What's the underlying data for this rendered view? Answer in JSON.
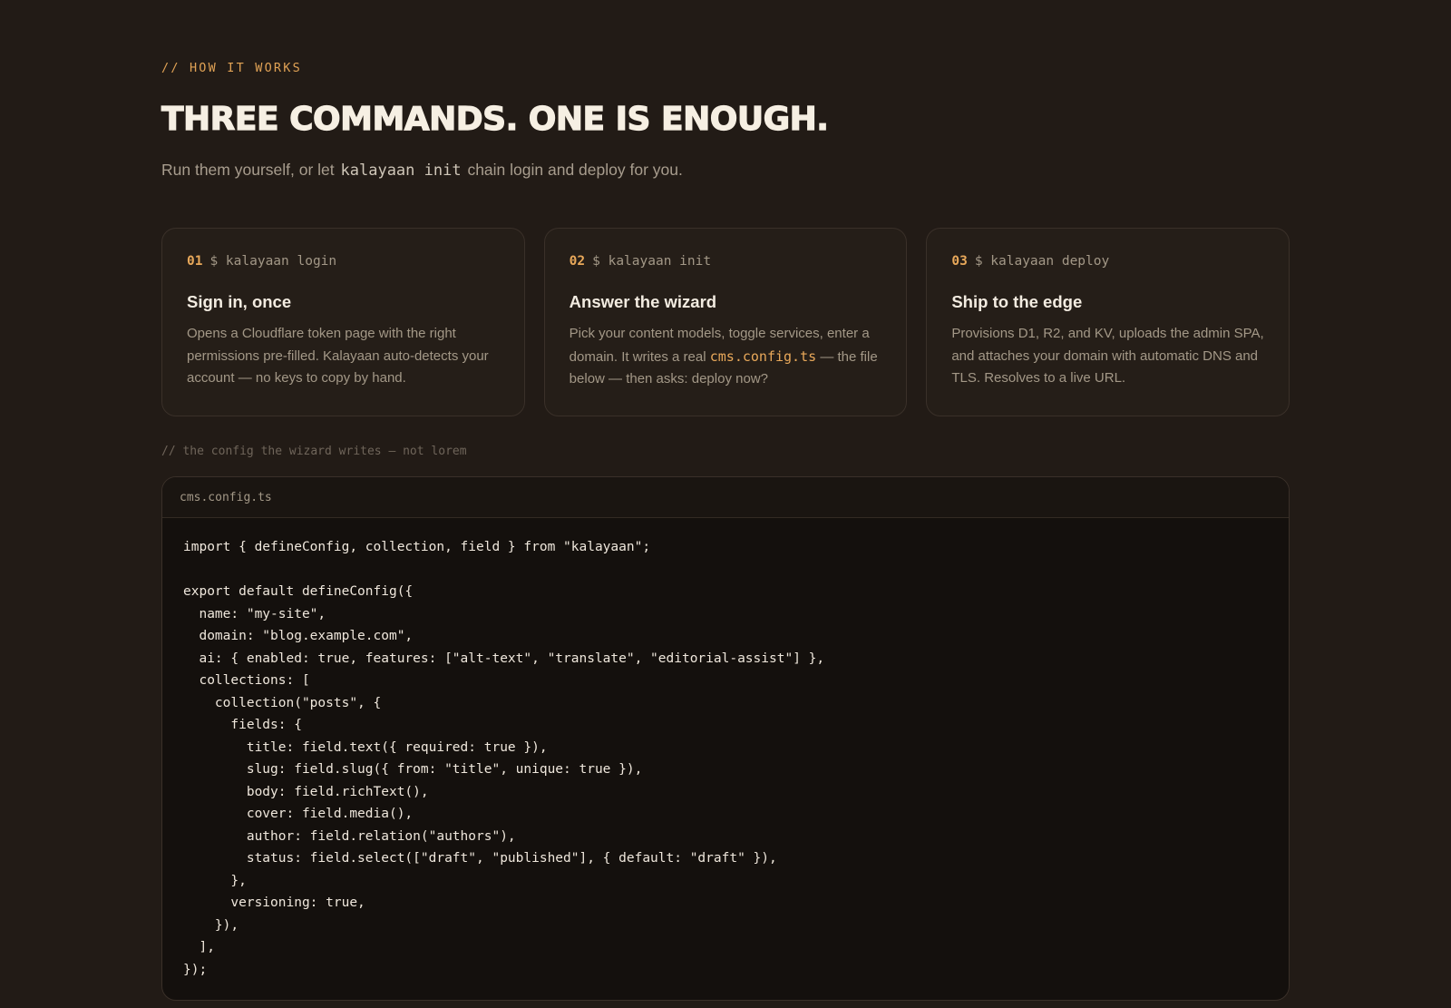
{
  "section": {
    "eyebrow": "// HOW IT WORKS",
    "title": "THREE COMMANDS. ONE IS ENOUGH.",
    "subtitle_before": "Run them yourself, or let",
    "subtitle_code": "kalayaan init",
    "subtitle_after": "chain login and deploy for you."
  },
  "steps": [
    {
      "number": "01",
      "command": "$ kalayaan login",
      "title": "Sign in, once",
      "description": "Opens a Cloudflare token page with the right permissions pre-filled. Kalayaan auto-detects your account — no keys to copy by hand."
    },
    {
      "number": "02",
      "command": "$ kalayaan init",
      "title": "Answer the wizard",
      "description_before": "Pick your content models, toggle services, enter a domain. It writes a real",
      "description_code": "cms.config.ts",
      "description_after": "— the file below — then asks: deploy now?"
    },
    {
      "number": "03",
      "command": "$ kalayaan deploy",
      "title": "Ship to the edge",
      "description": "Provisions D1, R2, and KV, uploads the admin SPA, and attaches your domain with automatic DNS and TLS. Resolves to a live URL."
    }
  ],
  "config": {
    "caption": "// the config the wizard writes — not lorem",
    "filename": "cms.config.ts",
    "code": "import { defineConfig, collection, field } from \"kalayaan\";\n\nexport default defineConfig({\n  name: \"my-site\",\n  domain: \"blog.example.com\",\n  ai: { enabled: true, features: [\"alt-text\", \"translate\", \"editorial-assist\"] },\n  collections: [\n    collection(\"posts\", {\n      fields: {\n        title: field.text({ required: true }),\n        slug: field.slug({ from: \"title\", unique: true }),\n        body: field.richText(),\n        cover: field.media(),\n        author: field.relation(\"authors\"),\n        status: field.select([\"draft\", \"published\"], { default: \"draft\" }),\n      },\n      versioning: true,\n    }),\n  ],\n});"
  },
  "colors": {
    "background": "#221b16",
    "accent": "#e8a85a",
    "muted": "#a39887",
    "code_background": "#14100d"
  }
}
